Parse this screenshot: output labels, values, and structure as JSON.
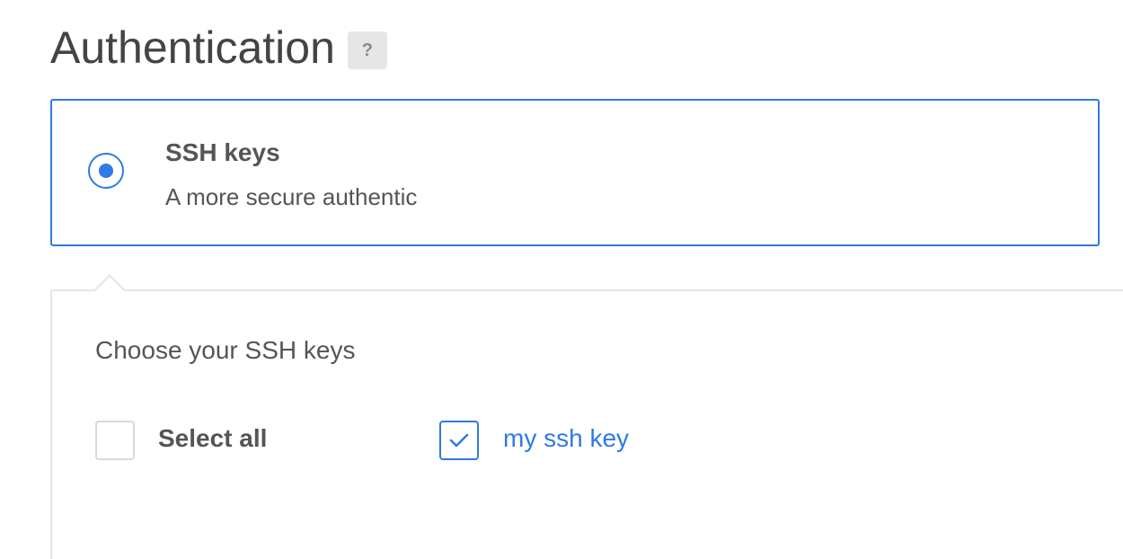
{
  "authentication": {
    "title": "Authentication",
    "help_label": "?"
  },
  "option": {
    "title": "SSH keys",
    "description": "A more secure authentic",
    "selected": true,
    "accent_color": "#2f7ae5"
  },
  "ssh_panel": {
    "label": "Choose your SSH keys",
    "select_all_label": "Select all",
    "select_all_checked": false,
    "keys": [
      {
        "name": "my ssh key",
        "checked": true
      }
    ]
  },
  "icons": {
    "help": "question-mark-icon",
    "radio": "radio-selected-icon",
    "check": "checkmark-icon"
  }
}
